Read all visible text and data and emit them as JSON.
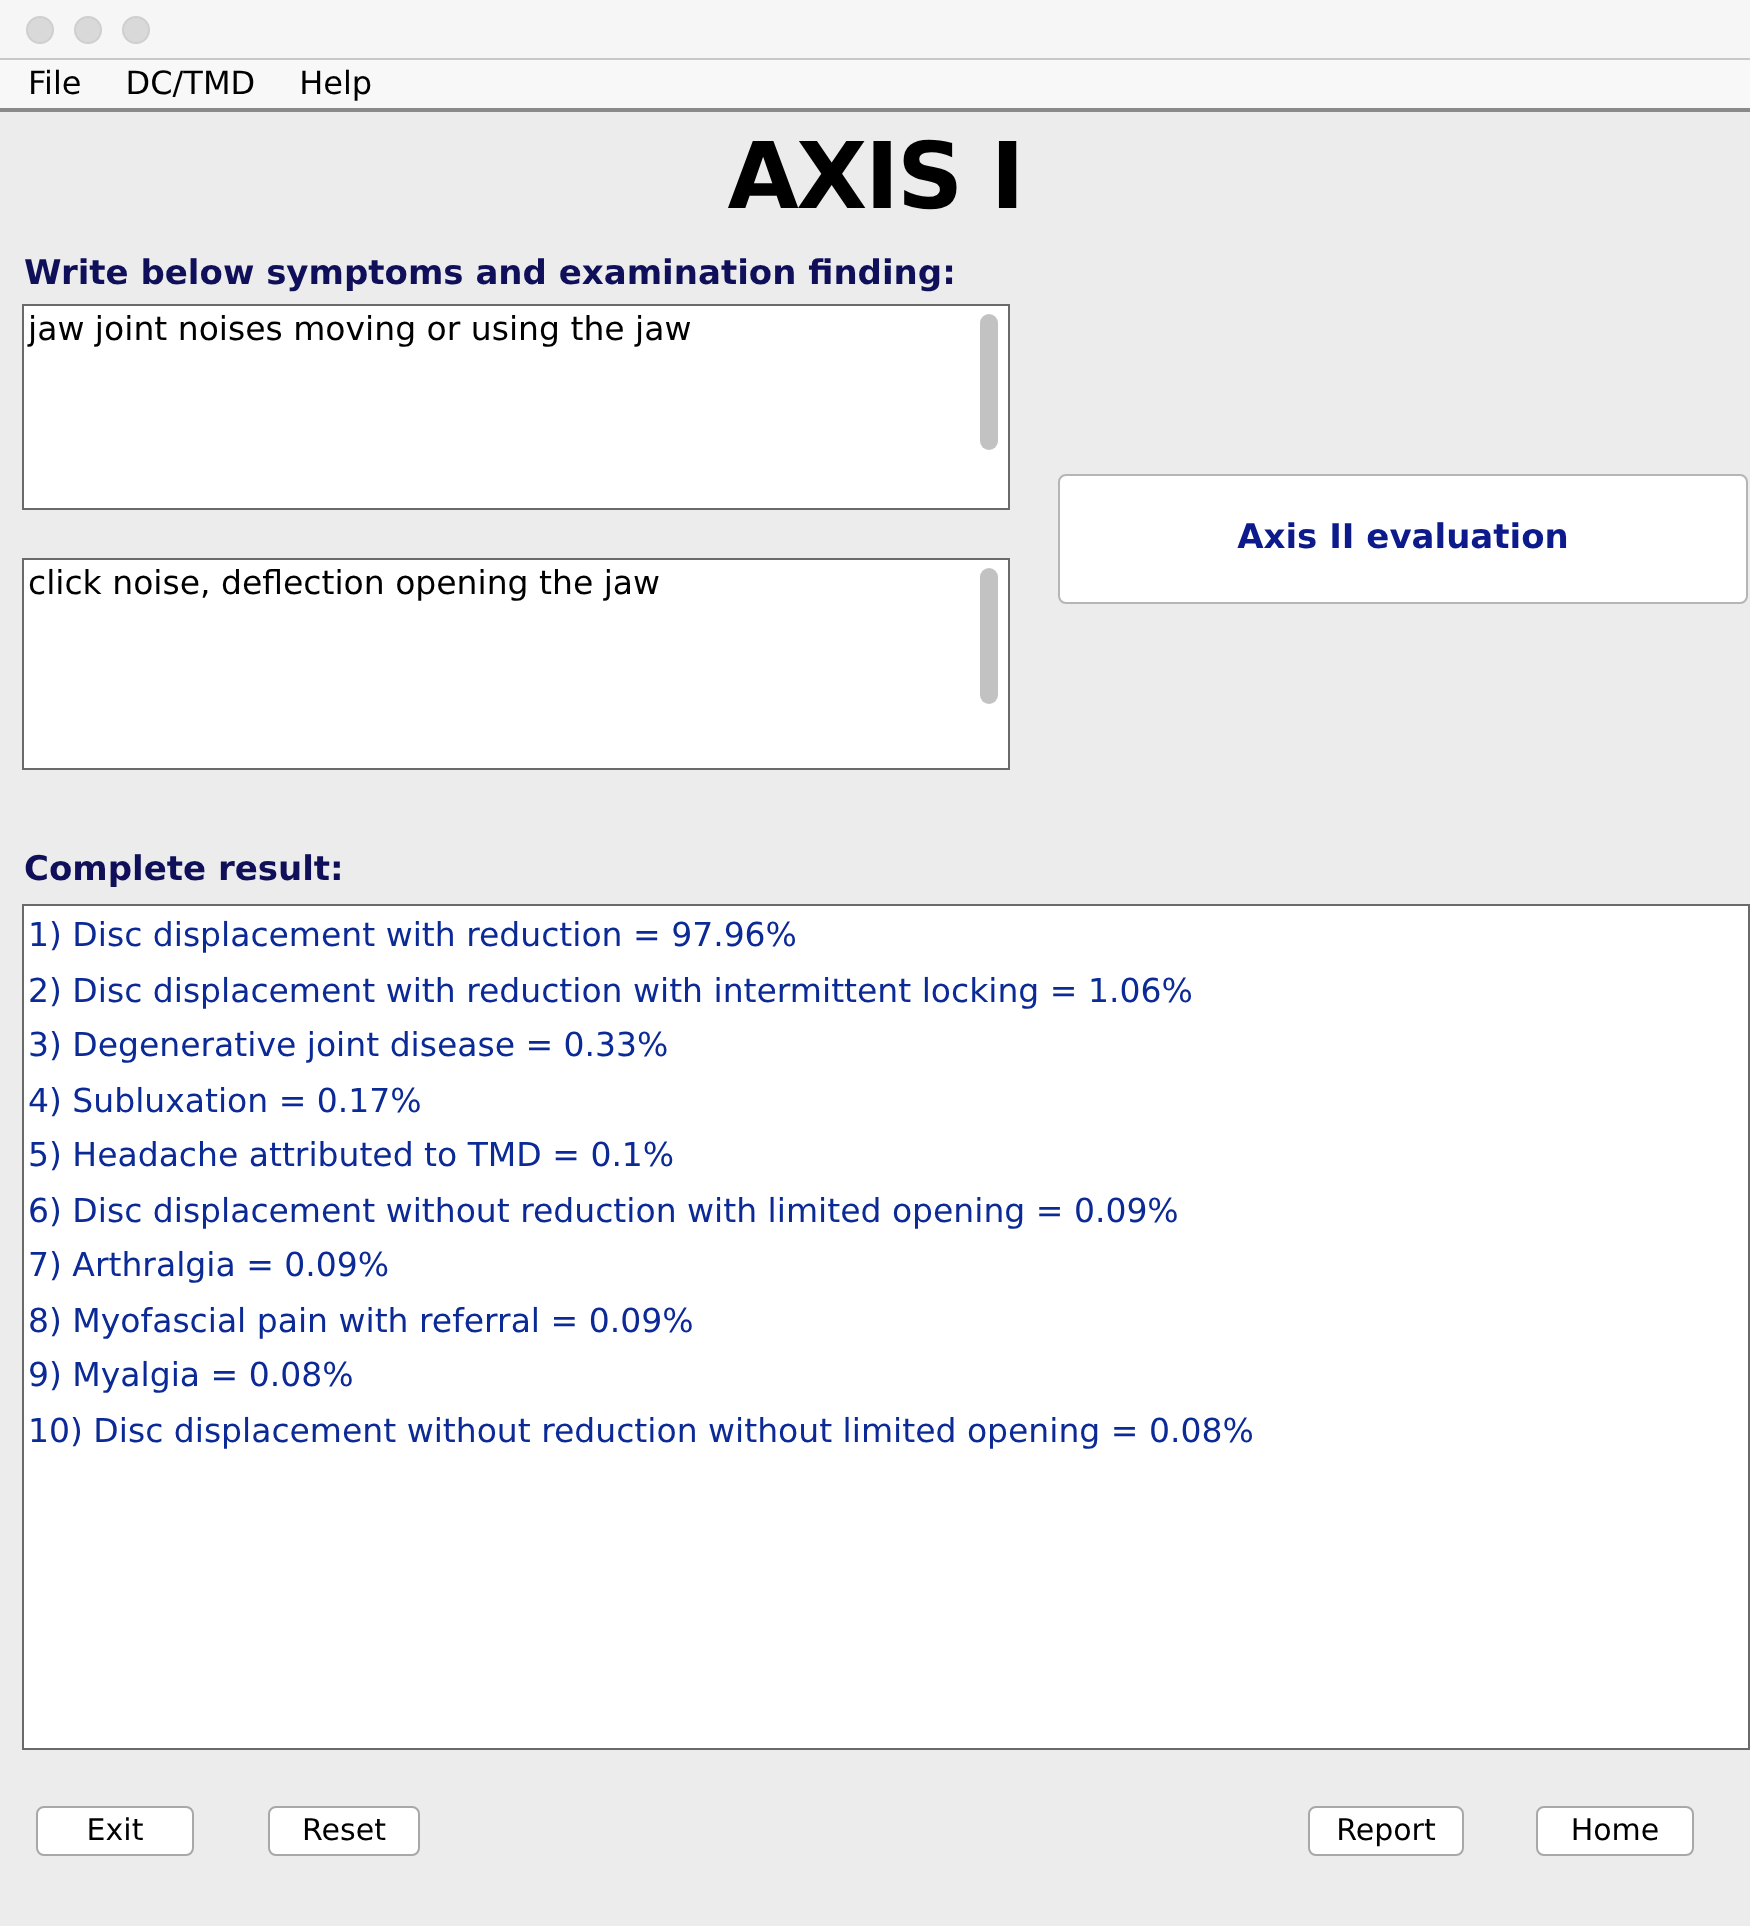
{
  "menu": [
    "File",
    "DC/TMD",
    "Help"
  ],
  "title": "AXIS I",
  "symptoms_label": "Write below symptoms and examination finding:",
  "symptoms_field": {
    "value": "jaw joint noises moving or using the jaw"
  },
  "findings_field": {
    "value": "click noise, deflection opening the jaw"
  },
  "axis2_button": "Axis II evaluation",
  "result_label": "Complete result:",
  "results": [
    "1) Disc displacement with reduction = 97.96%",
    "2) Disc displacement with reduction with intermittent locking = 1.06%",
    "3) Degenerative joint disease = 0.33%",
    "4) Subluxation = 0.17%",
    "5) Headache attributed to TMD = 0.1%",
    "6) Disc displacement without reduction with limited opening = 0.09%",
    "7) Arthralgia = 0.09%",
    "8) Myofascial pain with referral = 0.09%",
    "9) Myalgia = 0.08%",
    "10) Disc displacement without reduction without limited opening = 0.08%"
  ],
  "buttons_left": [
    "Exit",
    "Reset"
  ],
  "buttons_right": [
    "Report",
    "Home"
  ]
}
